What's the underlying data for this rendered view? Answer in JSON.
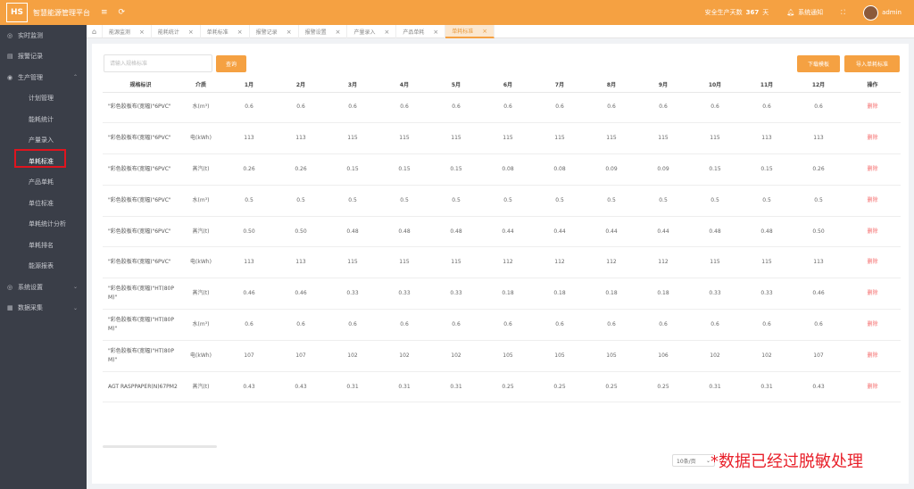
{
  "header": {
    "logo_text": "HS",
    "app_title": "智慧能源管理平台",
    "menu_icon": "menu-fold-icon",
    "refresh_icon": "refresh-icon",
    "safe_days_label": "安全生产天数",
    "safe_days_value": "367",
    "safe_days_unit": "天",
    "notice_label": "系统通知",
    "username": "admin"
  },
  "sidebar": {
    "items": [
      {
        "label": "实时监测",
        "icon": "monitor-icon"
      },
      {
        "label": "报警记录",
        "icon": "alarm-icon"
      },
      {
        "label": "生产管理",
        "icon": "factory-icon",
        "expanded": true
      }
    ],
    "sub_items": [
      "计划管理",
      "能耗统计",
      "产量录入",
      "单耗标准",
      "产品单耗",
      "单位标准",
      "单耗统计分析",
      "单耗排名",
      "能源报表"
    ],
    "after_items": [
      {
        "label": "系统设置",
        "icon": "settings-icon"
      },
      {
        "label": "数据采集",
        "icon": "data-icon"
      }
    ]
  },
  "tabs": [
    "能源监测",
    "能耗统计",
    "单耗标准",
    "报警记录",
    "报警设置",
    "产量录入",
    "产品单耗",
    "单耗标准"
  ],
  "toolbar": {
    "search_placeholder": "请输入规格标准",
    "search_button": "查询",
    "download_button": "下载模板",
    "import_button": "导入单耗标准"
  },
  "table": {
    "headers": [
      "规格标识",
      "介质",
      "1月",
      "2月",
      "3月",
      "4月",
      "5月",
      "6月",
      "7月",
      "8月",
      "9月",
      "10月",
      "11月",
      "12月",
      "操作"
    ],
    "rows": [
      {
        "name": "\"彩色胶板布(宽幅)\"6PVC\"",
        "medium": "水(m³)",
        "values": [
          "0.6",
          "0.6",
          "0.6",
          "0.6",
          "0.6",
          "0.6",
          "0.6",
          "0.6",
          "0.6",
          "0.6",
          "0.6",
          "0.6"
        ]
      },
      {
        "name": "\"彩色胶板布(宽幅)\"6PVC\"",
        "medium": "电(kWh)",
        "values": [
          "113",
          "113",
          "115",
          "115",
          "115",
          "115",
          "115",
          "115",
          "115",
          "115",
          "113",
          "113"
        ]
      },
      {
        "name": "\"彩色胶板布(宽幅)\"6PVC\"",
        "medium": "蒸汽(t)",
        "values": [
          "0.26",
          "0.26",
          "0.15",
          "0.15",
          "0.15",
          "0.08",
          "0.08",
          "0.09",
          "0.09",
          "0.15",
          "0.15",
          "0.26"
        ]
      },
      {
        "name": "\"彩色胶板布(宽幅)\"6PVC\"",
        "medium": "水(m³)",
        "values": [
          "0.5",
          "0.5",
          "0.5",
          "0.5",
          "0.5",
          "0.5",
          "0.5",
          "0.5",
          "0.5",
          "0.5",
          "0.5",
          "0.5"
        ]
      },
      {
        "name": "\"彩色胶板布(宽幅)\"6PVC\"",
        "medium": "蒸汽(t)",
        "values": [
          "0.50",
          "0.50",
          "0.48",
          "0.48",
          "0.48",
          "0.44",
          "0.44",
          "0.44",
          "0.44",
          "0.48",
          "0.48",
          "0.50"
        ]
      },
      {
        "name": "\"彩色胶板布(宽幅)\"6PVC\"",
        "medium": "电(kWh)",
        "values": [
          "113",
          "113",
          "115",
          "115",
          "115",
          "112",
          "112",
          "112",
          "112",
          "115",
          "115",
          "113"
        ]
      },
      {
        "name": "\"彩色胶板布(宽幅)\"HT(80PM)\"",
        "medium": "蒸汽(t)",
        "values": [
          "0.46",
          "0.46",
          "0.33",
          "0.33",
          "0.33",
          "0.18",
          "0.18",
          "0.18",
          "0.18",
          "0.33",
          "0.33",
          "0.46"
        ]
      },
      {
        "name": "\"彩色胶板布(宽幅)\"HT(80PM)\"",
        "medium": "水(m³)",
        "values": [
          "0.6",
          "0.6",
          "0.6",
          "0.6",
          "0.6",
          "0.6",
          "0.6",
          "0.6",
          "0.6",
          "0.6",
          "0.6",
          "0.6"
        ]
      },
      {
        "name": "\"彩色胶板布(宽幅)\"HT(80PM)\"",
        "medium": "电(kWh)",
        "values": [
          "107",
          "107",
          "102",
          "102",
          "102",
          "105",
          "105",
          "105",
          "106",
          "102",
          "102",
          "107"
        ]
      },
      {
        "name": "AGT RASPPAPER(N)67PM2",
        "medium": "蒸汽(t)",
        "values": [
          "0.43",
          "0.43",
          "0.31",
          "0.31",
          "0.31",
          "0.25",
          "0.25",
          "0.25",
          "0.25",
          "0.31",
          "0.31",
          "0.43"
        ]
      }
    ],
    "op_label": "删除"
  },
  "pagination": {
    "page_size": "10条/页"
  },
  "watermark": "*数据已经过脱敏处理",
  "colors": {
    "accent": "#f5a142",
    "sidebar": "#3a3e48",
    "danger": "#f56c6c",
    "watermark": "#e8202a"
  }
}
